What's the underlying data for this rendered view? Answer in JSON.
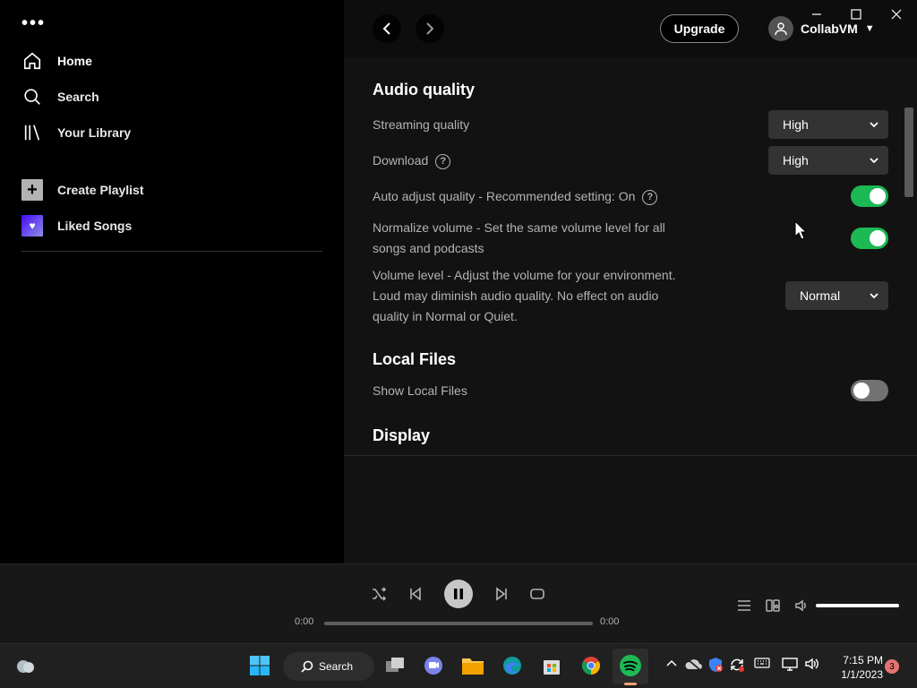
{
  "sidebar": {
    "more_glyph": "•••",
    "nav": [
      {
        "label": "Home",
        "icon": "home-icon"
      },
      {
        "label": "Search",
        "icon": "search-icon"
      },
      {
        "label": "Your Library",
        "icon": "library-icon"
      }
    ],
    "playlists": [
      {
        "label": "Create Playlist",
        "icon": "plus-icon"
      },
      {
        "label": "Liked Songs",
        "icon": "heart-icon"
      }
    ]
  },
  "header": {
    "upgrade_label": "Upgrade",
    "username": "CollabVM"
  },
  "settings": {
    "audio_quality": {
      "title": "Audio quality",
      "streaming_label": "Streaming quality",
      "streaming_value": "High",
      "download_label": "Download",
      "download_value": "High",
      "auto_adjust_label": "Auto adjust quality - Recommended setting: On",
      "auto_adjust_on": true,
      "normalize_line1": "Normalize volume - Set the same volume level for all",
      "normalize_line2": "songs and podcasts",
      "normalize_on": true,
      "volume_line1": "Volume level - Adjust the volume for your environment.",
      "volume_line2": "Loud may diminish audio quality. No effect on audio",
      "volume_line3": "quality in Normal or Quiet.",
      "volume_value": "Normal"
    },
    "local_files": {
      "title": "Local Files",
      "show_label": "Show Local Files",
      "show_on": false
    },
    "display": {
      "title": "Display"
    }
  },
  "player": {
    "elapsed": "0:00",
    "duration": "0:00",
    "progress": 0,
    "volume": 1.0
  },
  "taskbar": {
    "search_label": "Search",
    "time": "7:15 PM",
    "date": "1/1/2023",
    "notifications": "3"
  },
  "colors": {
    "accent": "#1db954",
    "background": "#121212",
    "sidebar": "#000000",
    "player": "#181818"
  }
}
